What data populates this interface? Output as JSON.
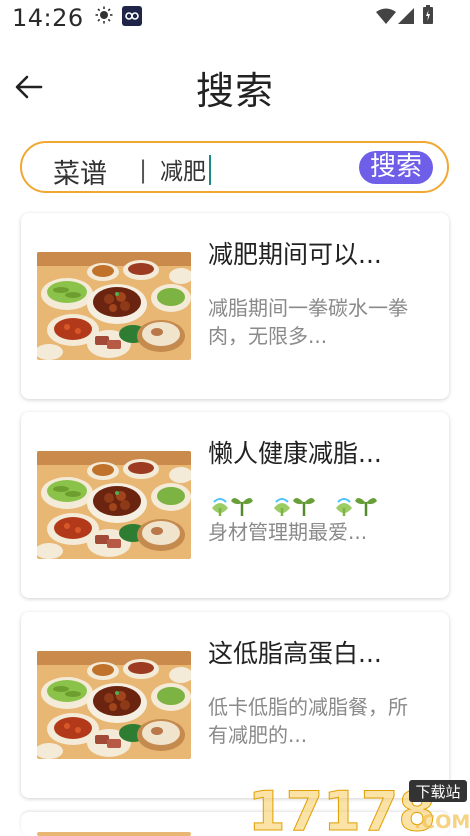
{
  "status_bar": {
    "time": "14:26"
  },
  "header": {
    "title": "搜索"
  },
  "search": {
    "category": "菜谱",
    "divider": "|",
    "value": "减肥",
    "button_label": "搜索"
  },
  "results": [
    {
      "title": "减肥期间可以...",
      "desc": "减脂期间一拳碳水一拳肉，无限多..."
    },
    {
      "title": "懒人健康减脂...",
      "desc": "身材管理期最爱..."
    },
    {
      "title": "这低脂高蛋白...",
      "desc": "低卡低脂的减脂餐，所有减肥的..."
    }
  ],
  "watermark": {
    "number": "17178",
    "tag": "下载站",
    "domain": ".COM"
  },
  "colors": {
    "accent_orange": "#f2a732",
    "button_purple": "#6f5fe8"
  }
}
